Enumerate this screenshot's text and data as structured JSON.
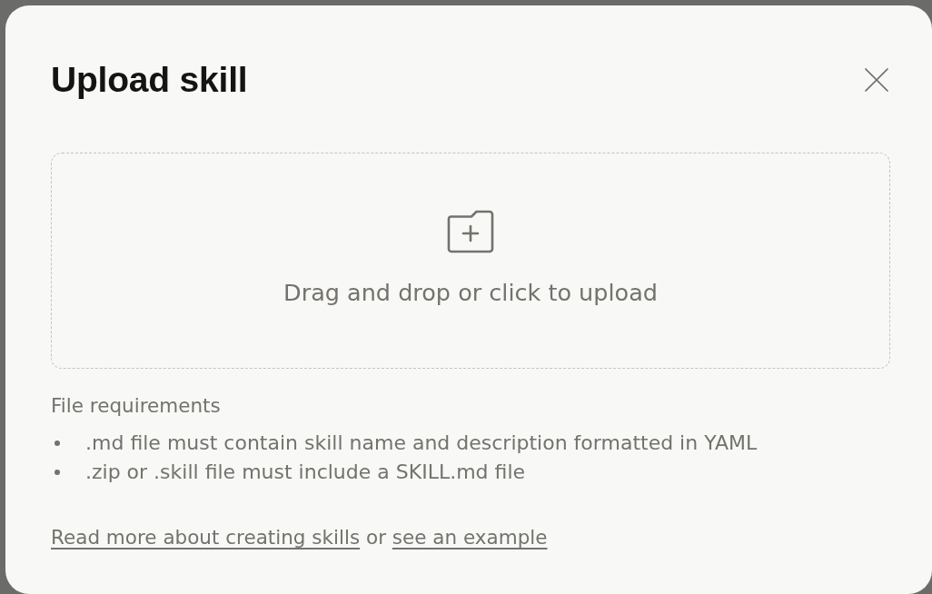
{
  "dialog": {
    "title": "Upload skill"
  },
  "dropzone": {
    "label": "Drag and drop or click to upload"
  },
  "requirements": {
    "heading": "File requirements",
    "items": [
      ".md file must contain skill name and description formatted in YAML",
      ".zip or .skill file must include a SKILL.md file"
    ]
  },
  "footer": {
    "parts": [
      {
        "kind": "link",
        "text": "Read more about creating skills"
      },
      {
        "kind": "text",
        "text": "or"
      },
      {
        "kind": "link",
        "text": "see an example"
      }
    ]
  }
}
